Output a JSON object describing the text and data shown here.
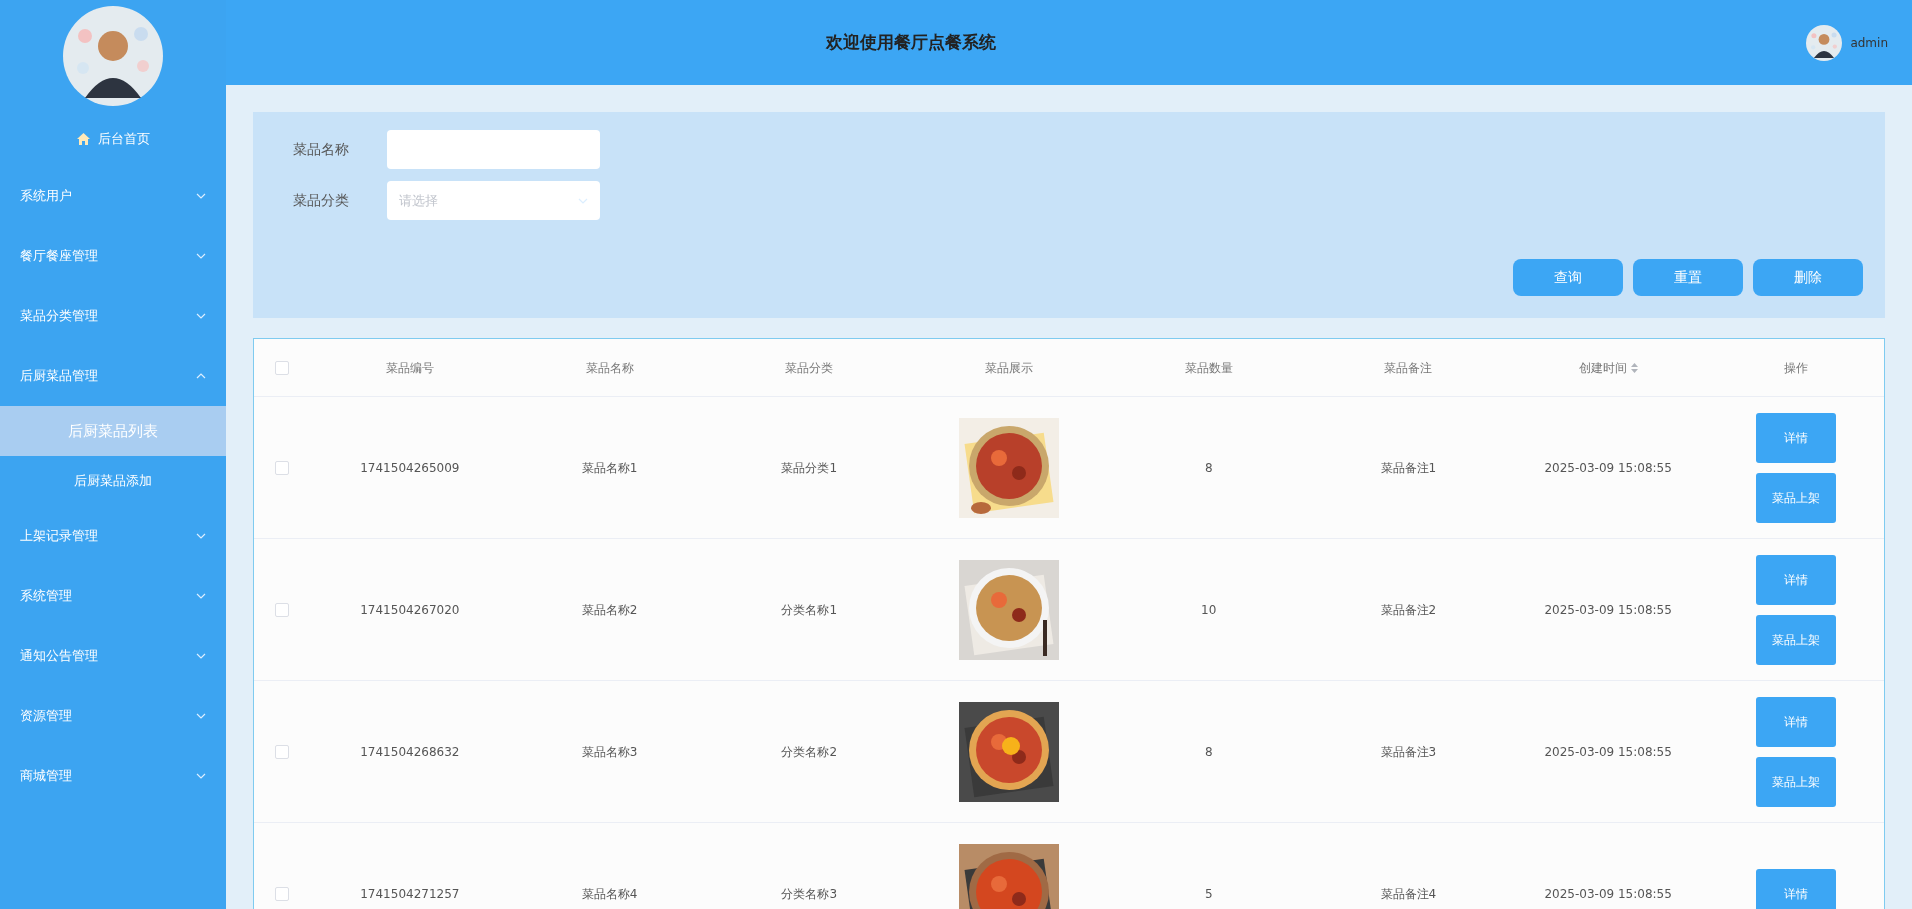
{
  "sidebar": {
    "home": {
      "label": "后台首页"
    },
    "items": [
      {
        "label": "系统用户",
        "expanded": false
      },
      {
        "label": "餐厅餐座管理",
        "expanded": false
      },
      {
        "label": "菜品分类管理",
        "expanded": false
      },
      {
        "label": "后厨菜品管理",
        "expanded": true,
        "children": [
          {
            "label": "后厨菜品列表",
            "selected": true
          },
          {
            "label": "后厨菜品添加",
            "selected": false
          }
        ]
      },
      {
        "label": "上架记录管理",
        "expanded": false
      },
      {
        "label": "系统管理",
        "expanded": false
      },
      {
        "label": "通知公告管理",
        "expanded": false
      },
      {
        "label": "资源管理",
        "expanded": false
      },
      {
        "label": "商城管理",
        "expanded": false
      }
    ]
  },
  "header": {
    "title": "欢迎使用餐厅点餐系统",
    "user": "admin"
  },
  "search": {
    "fields": [
      {
        "label": "菜品名称",
        "kind": "text"
      },
      {
        "label": "菜品分类",
        "kind": "select",
        "placeholder": "请选择"
      }
    ],
    "buttons": [
      "查询",
      "重置",
      "删除"
    ]
  },
  "table": {
    "select_all_checked": false,
    "columns": [
      {
        "label": "菜品编号",
        "sortable": false
      },
      {
        "label": "菜品名称",
        "sortable": false
      },
      {
        "label": "菜品分类",
        "sortable": false
      },
      {
        "label": "菜品展示",
        "sortable": false
      },
      {
        "label": "菜品数量",
        "sortable": false
      },
      {
        "label": "菜品备注",
        "sortable": false
      },
      {
        "label": "创建时间",
        "sortable": true
      },
      {
        "label": "操作",
        "sortable": false
      }
    ],
    "rows": [
      {
        "checked": false,
        "cells": [
          "1741504265009",
          "菜品名称1",
          "菜品分类1",
          {
            "kind": "picture"
          },
          "8",
          "菜品备注1",
          "2025-03-09 15:08:55",
          {
            "kind": "actions",
            "buttons": [
              "详情",
              "菜品上架"
            ]
          }
        ]
      },
      {
        "checked": false,
        "cells": [
          "1741504267020",
          "菜品名称2",
          "分类名称1",
          {
            "kind": "picture"
          },
          "10",
          "菜品备注2",
          "2025-03-09 15:08:55",
          {
            "kind": "actions",
            "buttons": [
              "详情",
              "菜品上架"
            ]
          }
        ]
      },
      {
        "checked": false,
        "cells": [
          "1741504268632",
          "菜品名称3",
          "分类名称2",
          {
            "kind": "picture"
          },
          "8",
          "菜品备注3",
          "2025-03-09 15:08:55",
          {
            "kind": "actions",
            "buttons": [
              "详情",
              "菜品上架"
            ]
          }
        ]
      },
      {
        "checked": false,
        "cells": [
          "1741504271257",
          "菜品名称4",
          "分类名称3",
          {
            "kind": "picture"
          },
          "5",
          "菜品备注4",
          "2025-03-09 15:08:55",
          {
            "kind": "actions",
            "buttons": [
              "详情"
            ]
          }
        ]
      }
    ]
  }
}
